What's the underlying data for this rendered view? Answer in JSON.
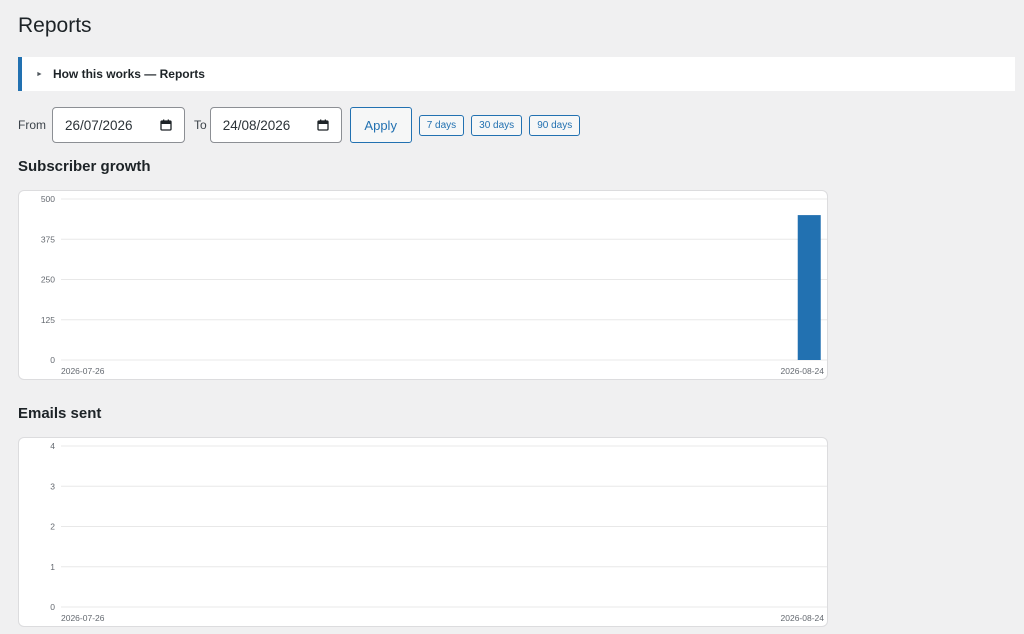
{
  "page": {
    "title": "Reports"
  },
  "howto": {
    "label": "How this works — Reports",
    "icon": "triangle-right-icon"
  },
  "filters": {
    "from_label": "From",
    "from_value": "26/07/2026",
    "to_label": "To",
    "to_value": "24/08/2026",
    "apply_label": "Apply",
    "presets": [
      "7 days",
      "30 days",
      "90 days"
    ]
  },
  "charts": {
    "subscriber_growth_title": "Subscriber growth",
    "emails_sent_title": "Emails sent"
  },
  "colors": {
    "accent": "#2271b1",
    "bar": "#2271b1",
    "grid": "#e5e5e5"
  },
  "chart_data": [
    {
      "type": "bar",
      "title": "Subscriber growth",
      "ylim": [
        0,
        500
      ],
      "y_ticks": [
        0,
        125,
        250,
        375,
        500
      ],
      "x_ticks": [
        "2026-07-26",
        "2026-08-24"
      ],
      "x_range": [
        "2026-07-26",
        "2026-08-24"
      ],
      "series": [
        {
          "x": [
            "2026-08-24"
          ],
          "values": [
            450
          ]
        }
      ],
      "grid": true
    },
    {
      "type": "bar",
      "title": "Emails sent",
      "ylim": [
        0,
        4
      ],
      "y_ticks": [
        0,
        1,
        2,
        3,
        4
      ],
      "x_ticks": [
        "2026-07-26",
        "2026-08-24"
      ],
      "x_range": [
        "2026-07-26",
        "2026-08-24"
      ],
      "series": [
        {
          "x": [],
          "values": []
        }
      ],
      "grid": true
    }
  ]
}
